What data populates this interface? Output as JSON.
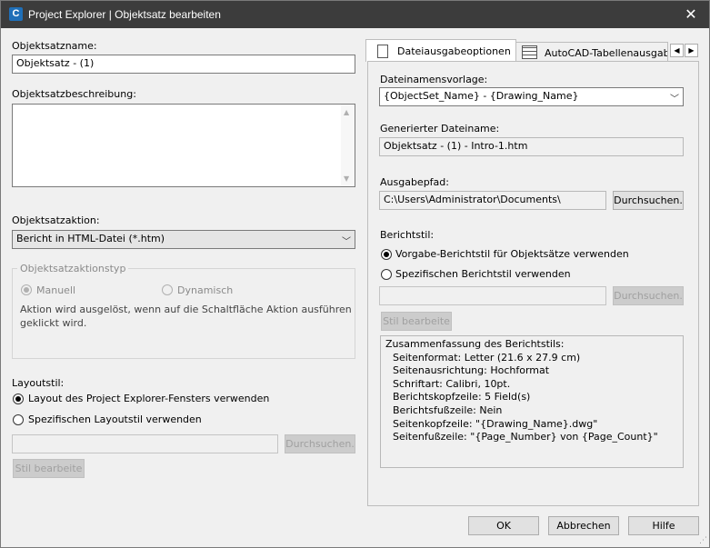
{
  "window": {
    "title": "Project Explorer | Objektsatz bearbeiten",
    "app_icon_letter": "C"
  },
  "left": {
    "name_label": "Objektsatzname:",
    "name_value": "Objektsatz - (1)",
    "desc_label": "Objektsatzbeschreibung:",
    "desc_value": "",
    "action_label": "Objektsatzaktion:",
    "action_value": "Bericht in HTML-Datei (*.htm)",
    "action_type_group": {
      "title": "Objektsatzaktionstyp",
      "radio_manual": "Manuell",
      "radio_dynamic": "Dynamisch",
      "description_line1": "Aktion wird ausgelöst, wenn auf die Schaltfläche Aktion ausführen",
      "description_line2": "geklickt wird."
    },
    "layout_label": "Layoutstil:",
    "layout_radio_window": "Layout des Project Explorer-Fensters verwenden",
    "layout_radio_specific": "Spezifischen Layoutstil verwenden",
    "layout_path": "",
    "browse_label": "Durchsuchen.",
    "edit_style_label": "Stil bearbeite"
  },
  "tabs": {
    "tab1": "Dateiausgabeoptionen",
    "tab2": "AutoCAD-Tabellenausgabe"
  },
  "right": {
    "template_label": "Dateinamensvorlage:",
    "template_value": "{ObjectSet_Name} - {Drawing_Name}",
    "generated_label": "Generierter Dateiname:",
    "generated_value": "Objektsatz - (1) - Intro-1.htm",
    "output_label": "Ausgabepfad:",
    "output_value": "C:\\Users\\Administrator\\Documents\\",
    "browse_label": "Durchsuchen.",
    "report_style_label": "Berichtstil:",
    "radio_default": "Vorgabe-Berichtstil für Objektsätze verwenden",
    "radio_specific": "Spezifischen Berichtstil verwenden",
    "specific_path": "",
    "browse2_label": "Durchsuchen.",
    "edit_style_label": "Stil bearbeite",
    "summary": {
      "heading": "Zusammenfassung des Berichtstils:",
      "line1": "Seitenformat: Letter (21.6 x 27.9 cm)",
      "line2": "Seitenausrichtung: Hochformat",
      "line3": "Schriftart: Calibri, 10pt.",
      "line4": "Berichtskopfzeile: 5 Field(s)",
      "line5": "Berichtsfußzeile: Nein",
      "line6": "Seitenkopfzeile: \"{Drawing_Name}.dwg\"",
      "line7": "Seitenfußzeile: \"{Page_Number} von {Page_Count}\""
    }
  },
  "footer": {
    "ok": "OK",
    "cancel": "Abbrechen",
    "help": "Hilfe"
  },
  "colors": {
    "titlebar": "#3c3c3c",
    "icon": "#1f6fb8",
    "dialog_bg": "#f0f0f0"
  }
}
